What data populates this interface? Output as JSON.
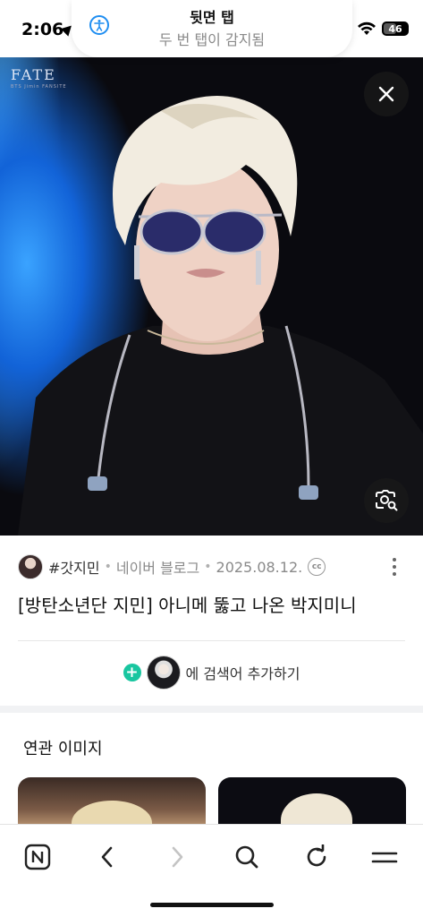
{
  "status_bar": {
    "time": "2:06",
    "battery": "46"
  },
  "a11y_banner": {
    "title": "뒷면 탭",
    "subtitle": "두 번 탭이 감지됨"
  },
  "photo": {
    "watermark": "FATE",
    "watermark_sub": "BTS Jimin FANSITE"
  },
  "image_info": {
    "blog_name": "#갓지민",
    "source": "네이버 블로그",
    "date": "2025.08.12.",
    "cc_label": "cc",
    "title": "[방탄소년단 지민] 아니메 뚫고 나온 박지미니"
  },
  "add_search": {
    "label": "에 검색어 추가하기"
  },
  "related": {
    "title": "연관 이미지"
  },
  "toolbar": {
    "home_label": "N"
  },
  "colors": {
    "accent_green": "#19c6a0",
    "a11y_blue": "#1f8ef1"
  },
  "icons": [
    "location-arrow-icon",
    "accessibility-icon",
    "wifi-icon",
    "battery-icon",
    "close-icon",
    "lens-search-icon",
    "cc-icon",
    "more-icon",
    "plus-icon",
    "naver-home-icon",
    "back-icon",
    "forward-icon",
    "search-icon",
    "refresh-icon",
    "menu-icon"
  ]
}
